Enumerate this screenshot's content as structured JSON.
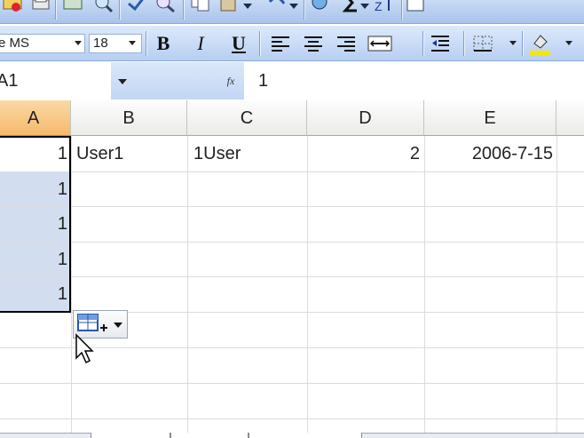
{
  "formatting": {
    "font_name": "e MS",
    "font_size": "18",
    "bold": "B",
    "italic": "I",
    "underline": "U"
  },
  "formula_bar": {
    "name_box": "A1",
    "fx": "fx",
    "formula": "1"
  },
  "grid": {
    "columns": [
      "A",
      "B",
      "C",
      "D",
      "E"
    ],
    "row1": {
      "a": "1",
      "b": "User1",
      "c": "1User",
      "d": "2",
      "e": "2006-7-15"
    },
    "col_a_filled": [
      "1",
      "1",
      "1",
      "1"
    ]
  },
  "colors": {
    "selected_header": "#f5b96c",
    "selection_fill": "#d2ddf0",
    "toolbar": "#b7cff2"
  }
}
